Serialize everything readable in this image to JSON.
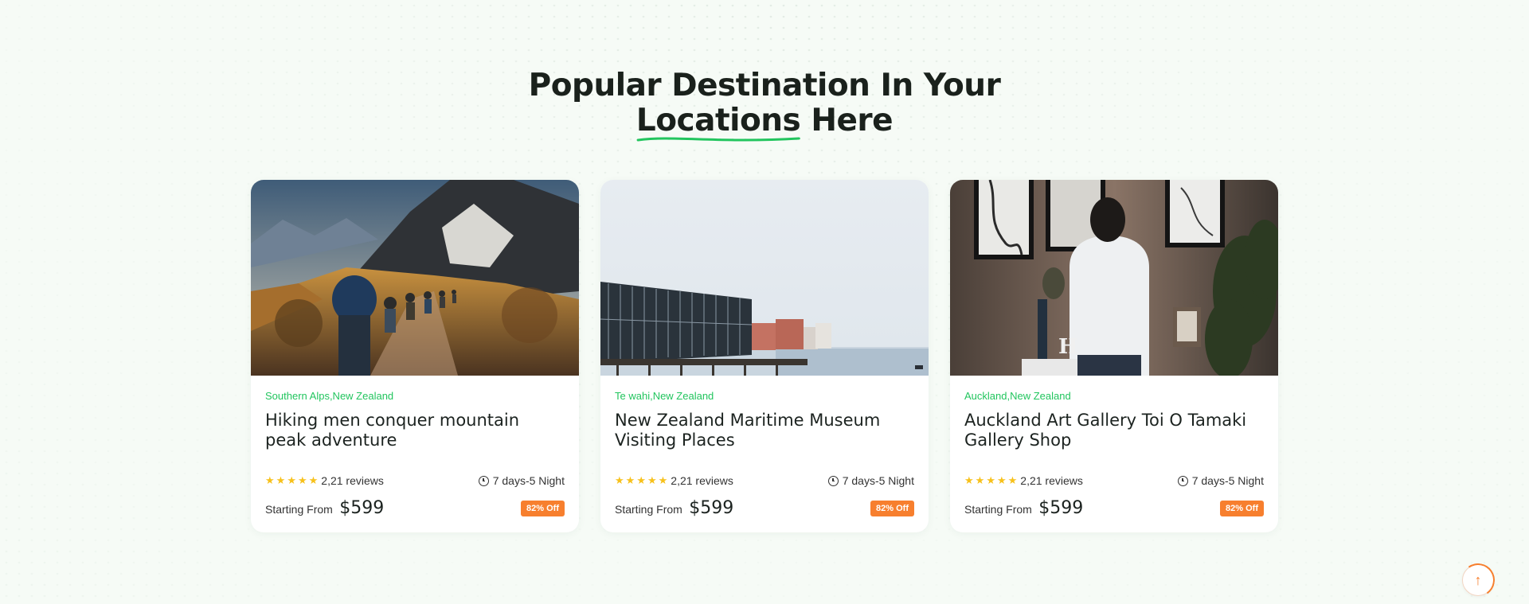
{
  "section": {
    "title_line1": "Popular Destination In Your",
    "title_highlight": "Locations",
    "title_rest": " Here"
  },
  "cards": [
    {
      "location": "Southern Alps,New Zealand",
      "title": "Hiking men conquer mountain peak adventure",
      "reviews": "2,21 reviews",
      "duration": "7 days-5 Night",
      "price_label": "Starting From",
      "price": "$599",
      "badge": "82% Off",
      "rating": 5
    },
    {
      "location": "Te wahi,New Zealand",
      "title": "New Zealand Maritime Museum Visiting Places",
      "reviews": "2,21 reviews",
      "duration": "7 days-5 Night",
      "price_label": "Starting From",
      "price": "$599",
      "badge": "82% Off",
      "rating": 5
    },
    {
      "location": "Auckland,New Zealand",
      "title": "Auckland Art Gallery Toi O Tamaki Gallery Shop",
      "reviews": "2,21 reviews",
      "duration": "7 days-5 Night",
      "price_label": "Starting From",
      "price": "$599",
      "badge": "82% Off",
      "rating": 5
    }
  ],
  "colors": {
    "accent_green": "#22c55e",
    "badge_orange": "#f77f2e",
    "star_yellow": "#f7c11b"
  }
}
